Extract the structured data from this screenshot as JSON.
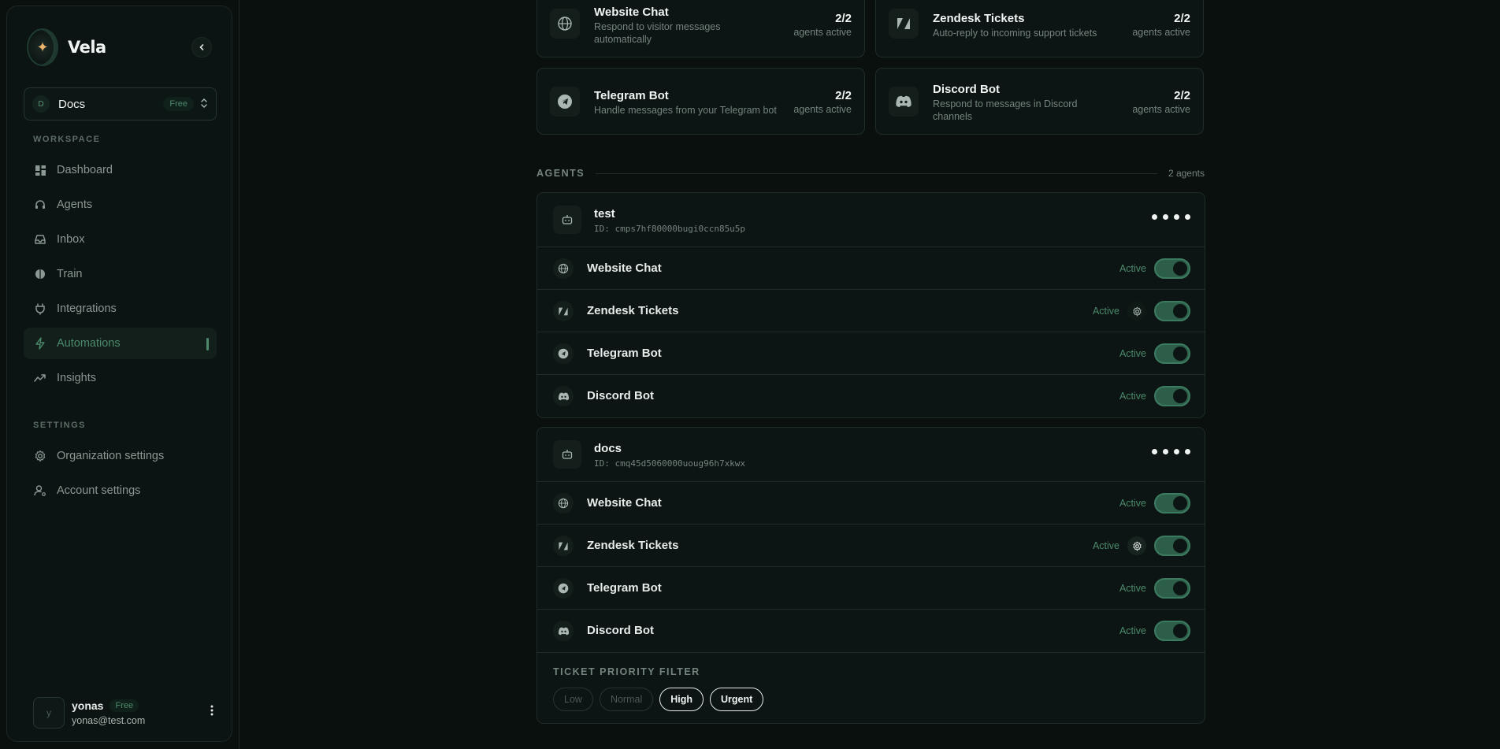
{
  "brand": {
    "name": "Vela"
  },
  "org": {
    "initial": "D",
    "name": "Docs",
    "plan": "Free"
  },
  "sidebar": {
    "workspace_label": "WORKSPACE",
    "workspace_items": [
      {
        "label": "Dashboard",
        "icon": "grid-icon"
      },
      {
        "label": "Agents",
        "icon": "headset-icon"
      },
      {
        "label": "Inbox",
        "icon": "inbox-icon"
      },
      {
        "label": "Train",
        "icon": "brain-icon"
      },
      {
        "label": "Integrations",
        "icon": "plug-icon"
      },
      {
        "label": "Automations",
        "icon": "bolt-icon",
        "active": true
      },
      {
        "label": "Insights",
        "icon": "trend-icon"
      }
    ],
    "settings_label": "SETTINGS",
    "settings_items": [
      {
        "label": "Organization settings",
        "icon": "gear-icon"
      },
      {
        "label": "Account settings",
        "icon": "user-gear-icon"
      }
    ]
  },
  "user": {
    "initial": "y",
    "name": "yonas",
    "plan": "Free",
    "email": "yonas@test.com"
  },
  "channels": [
    {
      "title": "Website Chat",
      "desc": "Respond to visitor messages automatically",
      "count": "2/2",
      "sub": "agents active",
      "icon": "globe-icon"
    },
    {
      "title": "Zendesk Tickets",
      "desc": "Auto-reply to incoming support tickets",
      "count": "2/2",
      "sub": "agents active",
      "icon": "zendesk-icon"
    },
    {
      "title": "Telegram Bot",
      "desc": "Handle messages from your Telegram bot",
      "count": "2/2",
      "sub": "agents active",
      "icon": "telegram-icon"
    },
    {
      "title": "Discord Bot",
      "desc": "Respond to messages in Discord channels",
      "count": "2/2",
      "sub": "agents active",
      "icon": "discord-icon"
    }
  ],
  "agents_section": {
    "label": "AGENTS",
    "count": "2 agents"
  },
  "agents": [
    {
      "name": "test",
      "id": "ID: cmps7hf80000bugi0ccn85u5p",
      "rows": [
        {
          "name": "Website Chat",
          "status": "Active",
          "on": true
        },
        {
          "name": "Zendesk Tickets",
          "status": "Active",
          "on": true
        },
        {
          "name": "Telegram Bot",
          "status": "Active",
          "on": true
        },
        {
          "name": "Discord Bot",
          "status": "Active",
          "on": true
        }
      ]
    },
    {
      "name": "docs",
      "id": "ID: cmq45d5060000uoug96h7xkwx",
      "rows": [
        {
          "name": "Website Chat",
          "status": "Active",
          "on": true
        },
        {
          "name": "Zendesk Tickets",
          "status": "Active",
          "on": true
        },
        {
          "name": "Telegram Bot",
          "status": "Active",
          "on": true
        },
        {
          "name": "Discord Bot",
          "status": "Active",
          "on": true
        }
      ],
      "filter": {
        "label": "TICKET PRIORITY FILTER",
        "options": [
          {
            "label": "Low",
            "selected": false
          },
          {
            "label": "Normal",
            "selected": false
          },
          {
            "label": "High",
            "selected": true
          },
          {
            "label": "Urgent",
            "selected": true
          }
        ]
      }
    }
  ],
  "colors": {
    "accent": "#4d8a6c",
    "background": "#0a100e",
    "toggle_on": "#2d5e4a"
  }
}
